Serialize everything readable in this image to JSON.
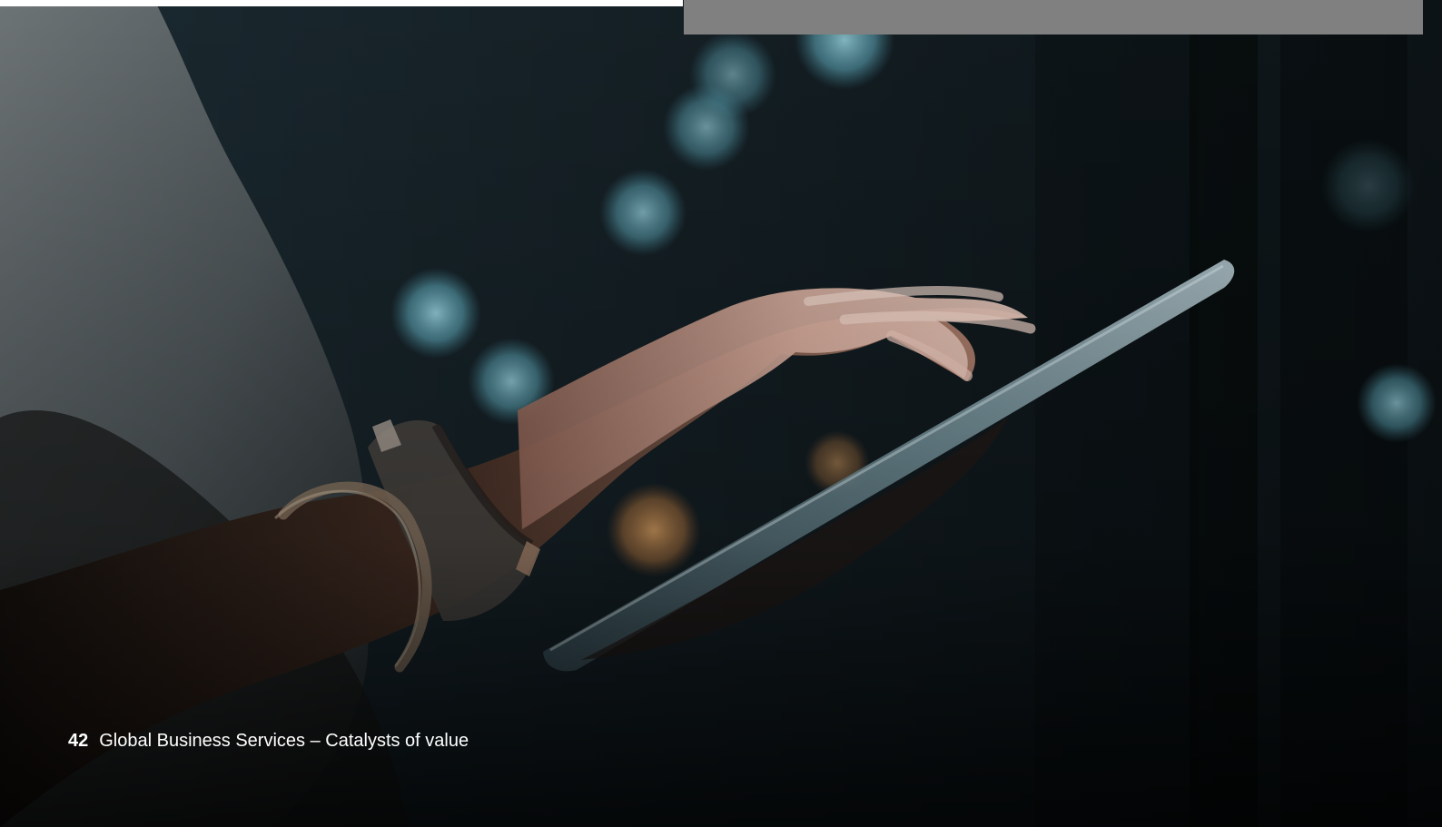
{
  "footer": {
    "page_number": "42",
    "title": "Global Business Services – Catalysts of value"
  }
}
